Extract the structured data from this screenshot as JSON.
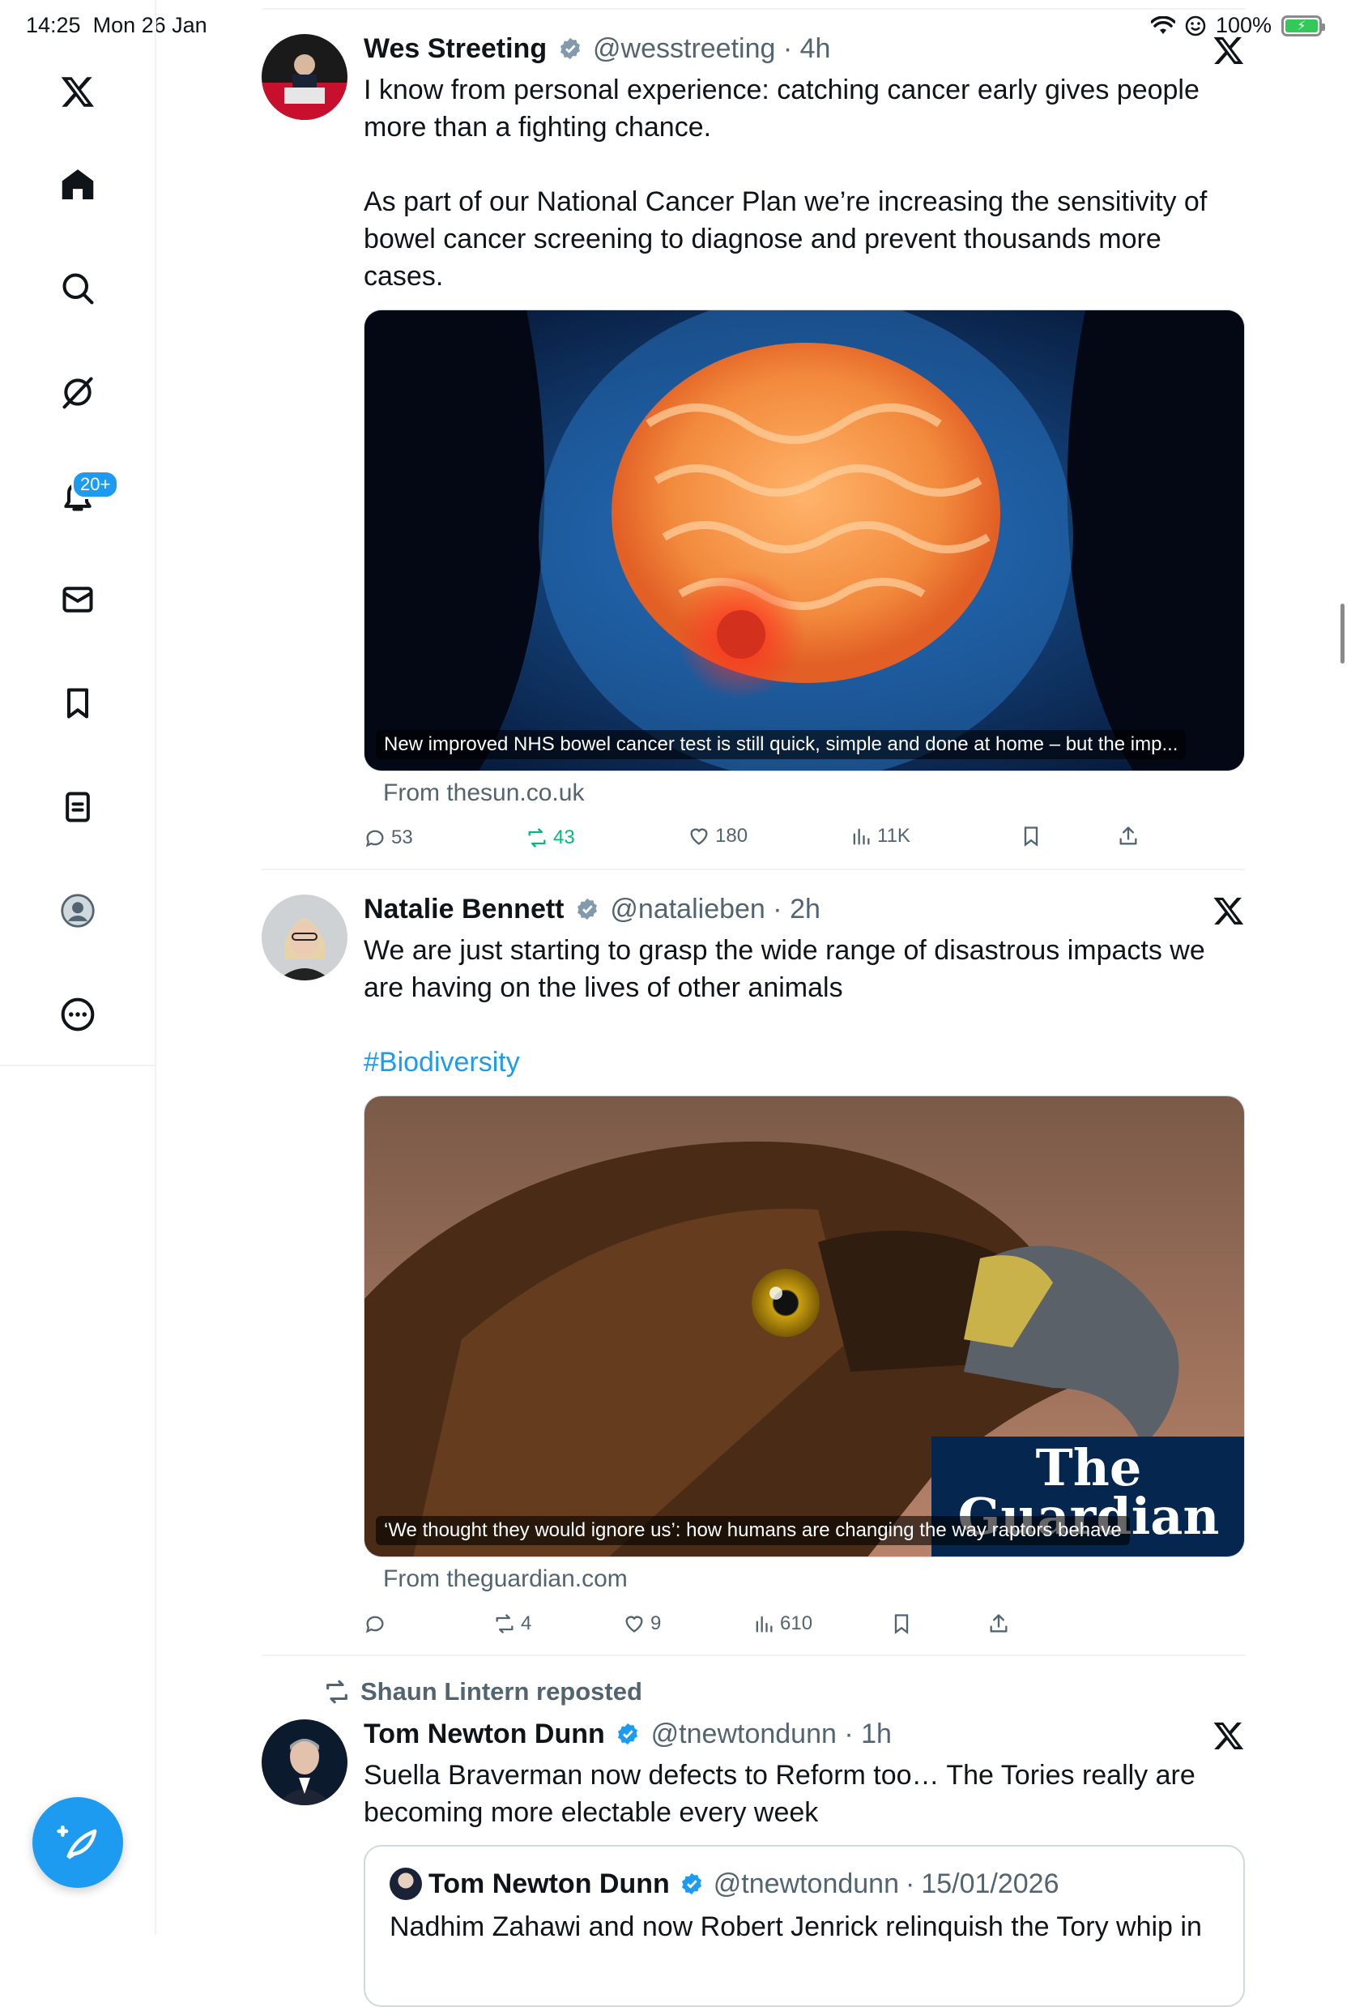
{
  "status": {
    "time": "14:25",
    "date": "Mon 26 Jan",
    "battery": "100%"
  },
  "sidebar": {
    "items": [
      {
        "name": "x-logo"
      },
      {
        "name": "home"
      },
      {
        "name": "search"
      },
      {
        "name": "grok"
      },
      {
        "name": "notifications",
        "badge": "20+"
      },
      {
        "name": "messages"
      },
      {
        "name": "bookmarks"
      },
      {
        "name": "lists"
      },
      {
        "name": "profile"
      },
      {
        "name": "more"
      }
    ]
  },
  "tweets": [
    {
      "name": "Wes Streeting",
      "handle": "@wesstreeting",
      "time": "4h",
      "para1": "I know from personal experience: catching cancer early gives people more than a fighting chance.",
      "para2": "As part of our National Cancer Plan we’re increasing the sensitivity of bowel cancer screening to diagnose and prevent thousands more cases.",
      "card_caption": "New improved NHS bowel cancer test is still quick, simple and done at home – but the imp...",
      "from": "From thesun.co.uk",
      "replies": "53",
      "reposts": "43",
      "likes": "180",
      "views": "11K"
    },
    {
      "name": "Natalie Bennett",
      "handle": "@natalieben",
      "time": "2h",
      "para1": "We are just starting to grasp the wide range of disastrous impacts we are having on the lives of other animals",
      "hashtag": "#Biodiversity",
      "card_caption": "‘We thought they would ignore us’: how humans are changing the way raptors behave",
      "card_logo": "The Guardian",
      "from": "From theguardian.com",
      "replies": "",
      "reposts": "4",
      "likes": "9",
      "views": "610"
    },
    {
      "reposted_by": "Shaun Lintern reposted",
      "name": "Tom Newton Dunn",
      "handle": "@tnewtondunn",
      "time": "1h",
      "para1": "Suella Braverman now defects to Reform too… The Tories really are becoming more electable every week",
      "quote": {
        "name": "Tom Newton Dunn",
        "handle": "@tnewtondunn",
        "date": "15/01/2026",
        "text": "Nadhim Zahawi and now Robert Jenrick relinquish the Tory whip in"
      }
    }
  ],
  "colors": {
    "accent": "#1d9bf0",
    "repost_green": "#00ba7c",
    "muted": "#536471"
  }
}
